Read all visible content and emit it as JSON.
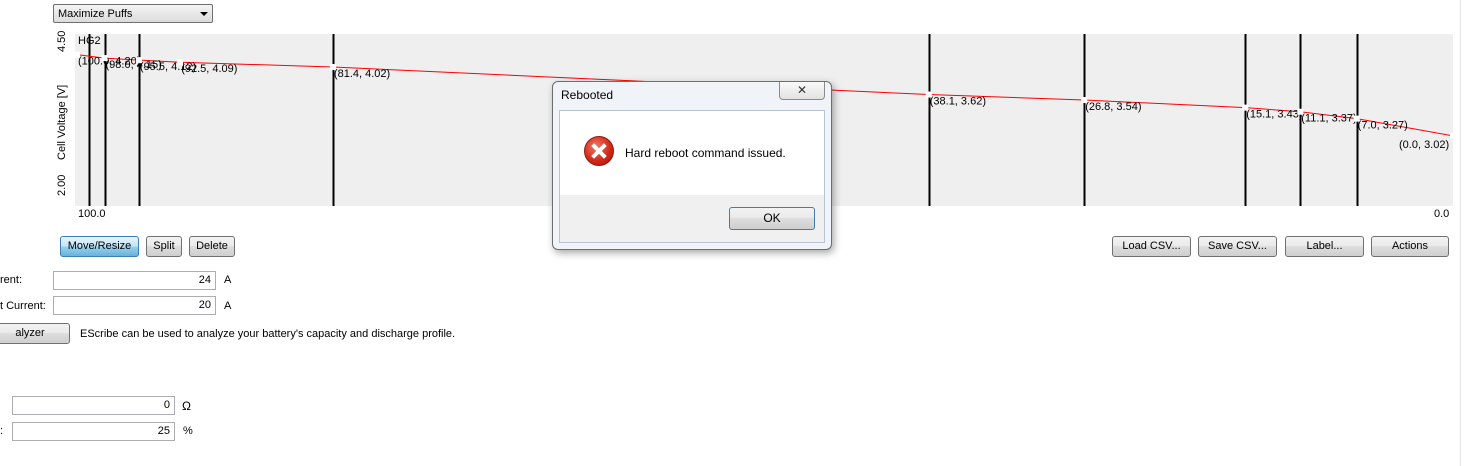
{
  "mode_select": {
    "value": "Maximize Puffs"
  },
  "chart": {
    "battery_label": "HG2",
    "y_label": "Cell Voltage [V]",
    "y_ticks": [
      "4.50",
      "2.00"
    ],
    "x_ticks": [
      "100.0",
      "0.0"
    ]
  },
  "chart_data": {
    "type": "line",
    "title": "",
    "xlabel": "",
    "ylabel": "Cell Voltage [V]",
    "xlim": [
      100.0,
      0.0
    ],
    "ylim": [
      2.0,
      4.5
    ],
    "series": [
      {
        "name": "HG2",
        "color": "#ff0000",
        "points": [
          {
            "x": 100.0,
            "y": 4.2,
            "label": "(100.0, 4.20)"
          },
          {
            "x": 98.0,
            "y": 4.15,
            "label": "(98.0, 4.15)"
          },
          {
            "x": 95.5,
            "y": 4.12,
            "label": "(95.5, 4.12)"
          },
          {
            "x": 92.5,
            "y": 4.09,
            "label": "(92.5, 4.09)"
          },
          {
            "x": 81.4,
            "y": 4.02,
            "label": "(81.4, 4.02)"
          },
          {
            "x": 38.1,
            "y": 3.62,
            "label": "(38.1, 3.62)"
          },
          {
            "x": 26.8,
            "y": 3.54,
            "label": "(26.8, 3.54)"
          },
          {
            "x": 15.1,
            "y": 3.43,
            "label": "(15.1, 3.43)"
          },
          {
            "x": 11.1,
            "y": 3.37,
            "label": "(11.1, 3.37)"
          },
          {
            "x": 7.0,
            "y": 3.27,
            "label": "(7.0, 3.27)"
          },
          {
            "x": 0.0,
            "y": 3.02,
            "label": "(0.0, 3.02)"
          }
        ]
      }
    ],
    "markers_x": [
      99.1,
      98.0,
      95.5,
      81.4,
      38.1,
      26.8,
      15.1,
      11.1,
      7.0
    ],
    "grid": false
  },
  "edit_buttons": {
    "move_resize": "Move/Resize",
    "split": "Split",
    "delete": "Delete"
  },
  "file_buttons": {
    "load_csv": "Load CSV...",
    "save_csv": "Save CSV...",
    "label": "Label...",
    "actions": "Actions"
  },
  "settings": {
    "current_label": "rent:",
    "current_value": "24",
    "current_unit": "A",
    "cutoff_label": "t Current:",
    "cutoff_value": "20",
    "cutoff_unit": "A",
    "analyzer_button": "alyzer",
    "analyzer_text": "EScribe can be used to analyze your battery's capacity and discharge profile.",
    "resistance_value": "0",
    "resistance_unit": "Ω",
    "percent_label": ":",
    "percent_value": "25",
    "percent_unit": "%"
  },
  "dialog": {
    "title": "Rebooted",
    "close_glyph": "✕",
    "message": "Hard reboot command issued.",
    "ok": "OK"
  }
}
